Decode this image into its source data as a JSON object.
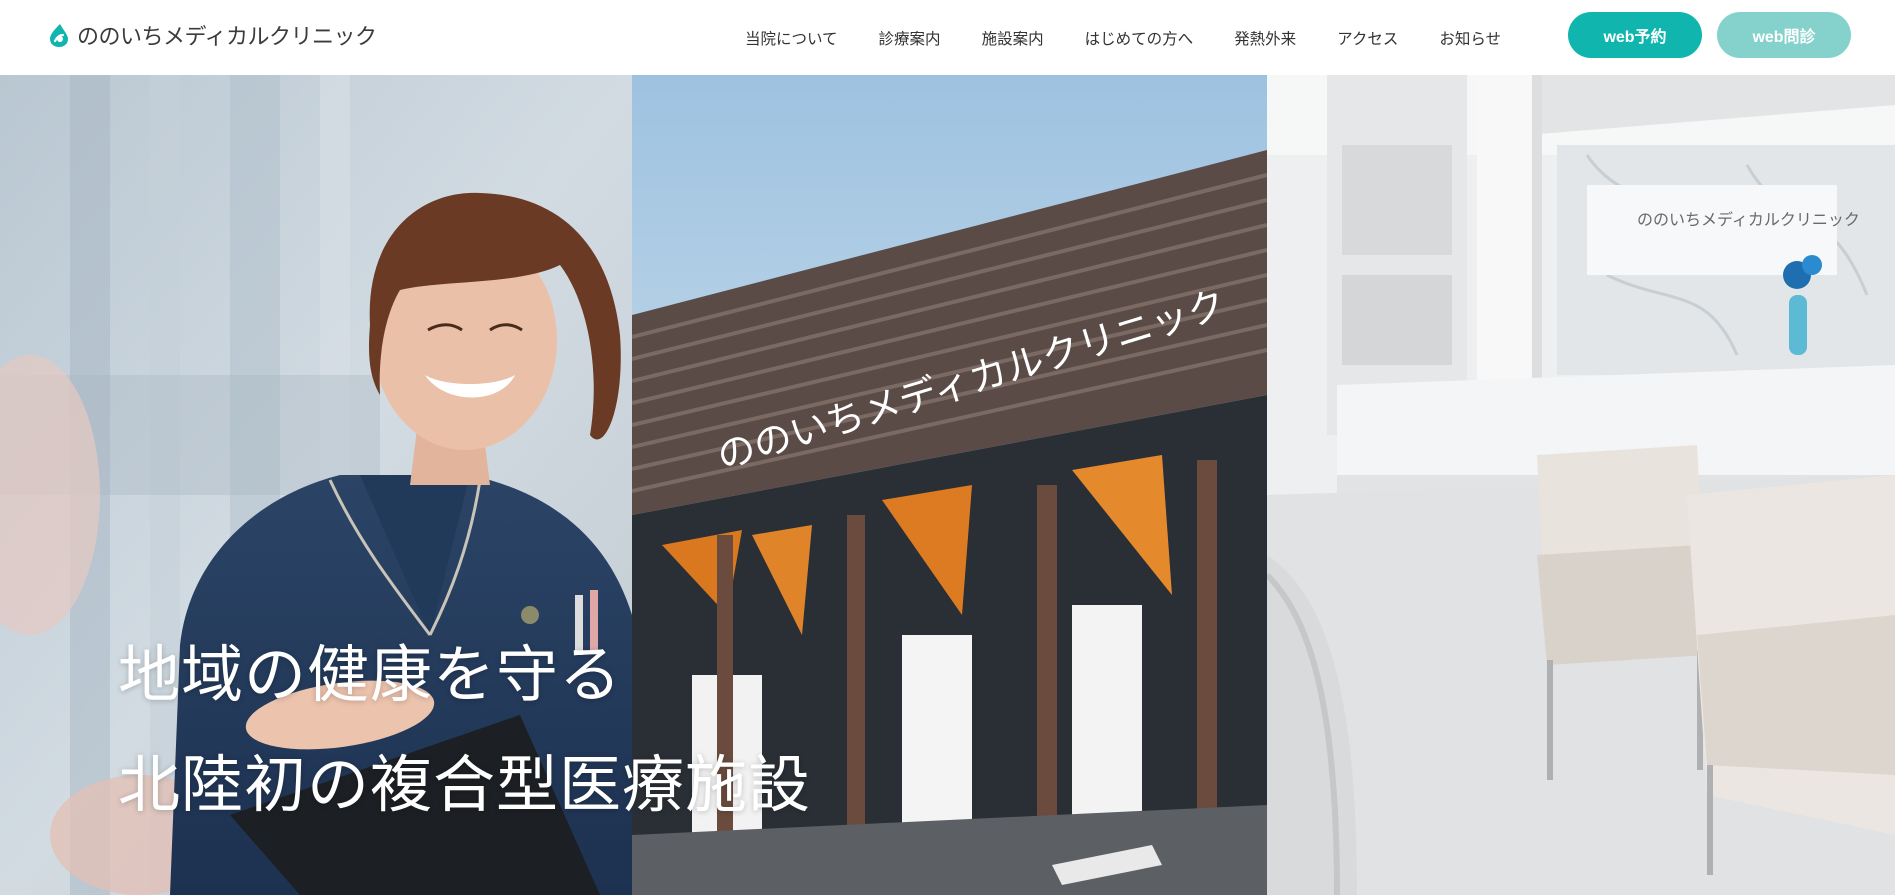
{
  "brand": {
    "logo_text": "ののいちメディカルクリニック",
    "accent_color": "#10b6ad",
    "accent_light_color": "#85d2cc",
    "logo_icon": "leaf-drop-icon"
  },
  "nav": {
    "items": [
      {
        "label": "当院について"
      },
      {
        "label": "診療案内"
      },
      {
        "label": "施設案内"
      },
      {
        "label": "はじめての方へ"
      },
      {
        "label": "発熱外来"
      },
      {
        "label": "アクセス"
      },
      {
        "label": "お知らせ"
      }
    ]
  },
  "cta": {
    "reserve_label": "web予約",
    "interview_label": "web問診"
  },
  "hero": {
    "line1": "地域の健康を守る",
    "line2": "北陸初の複合型医療施設",
    "sign_text": "ののいちメディカルクリニック",
    "reception_sign_text": "ののいちメディカルクリニック"
  }
}
